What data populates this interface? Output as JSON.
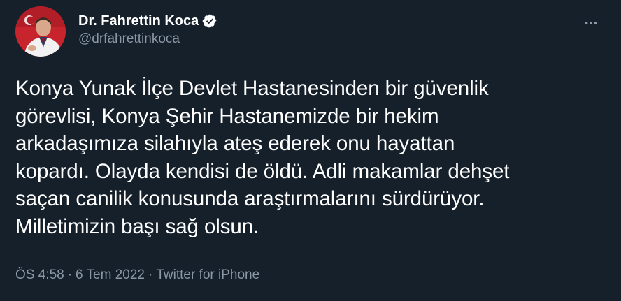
{
  "author": {
    "display_name": "Dr. Fahrettin Koca",
    "handle": "@drfahrettinkoca",
    "verified": true,
    "avatar_icon": "profile-photo"
  },
  "more_icon": "more-horizontal-icon",
  "tweet": {
    "lines": [
      "Konya Yunak İlçe Devlet Hastanesinden bir güvenlik",
      "görevlisi, Konya Şehir Hastanemizde bir hekim",
      "arkadaşımıza silahıyla ateş ederek onu hayattan",
      "kopardı. Olayda kendisi de öldü. Adli makamlar dehşet",
      "saçan canilik konusunda araştırmalarını sürdürüyor.",
      "Milletimizin başı sağ olsun."
    ]
  },
  "meta": {
    "time": "ÖS 4:58",
    "separator": "·",
    "date": "6 Tem 2022",
    "source": "Twitter for iPhone"
  },
  "colors": {
    "background": "#15202b",
    "text": "#ffffff",
    "secondary_text": "#8b98a5",
    "verified_badge": "#ffffff"
  }
}
